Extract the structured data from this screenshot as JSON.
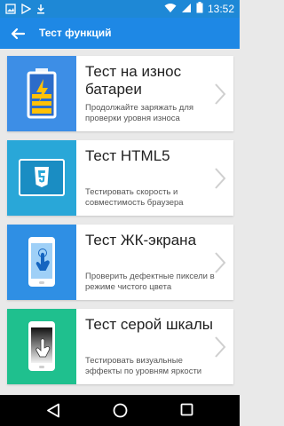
{
  "status": {
    "time": "13:52"
  },
  "appbar": {
    "title": "Тест функций"
  },
  "cards": [
    {
      "title": "Тест на износ батареи",
      "desc": "Продолжайте заряжать для проверки уровня износа",
      "icon": "battery-charging-icon",
      "bg": "#3d8ee6"
    },
    {
      "title": "Тест HTML5",
      "desc": "Тестировать скорость и совместимость браузера",
      "icon": "html5-icon",
      "bg": "#29a7d8"
    },
    {
      "title": "Тест ЖК-экрана",
      "desc": "Проверить дефектные пиксели в режиме чистого цвета",
      "icon": "phone-touch-icon",
      "bg": "#2f8fe4"
    },
    {
      "title": "Тест серой шкалы",
      "desc": "Тестировать визуальные эффекты по уровням яркости",
      "icon": "grayscale-phone-icon",
      "bg": "#1fc08e"
    }
  ],
  "colors": {
    "statusbar": "#1e88d6",
    "appbar": "#1e88e5",
    "background": "#e9e9e9"
  }
}
